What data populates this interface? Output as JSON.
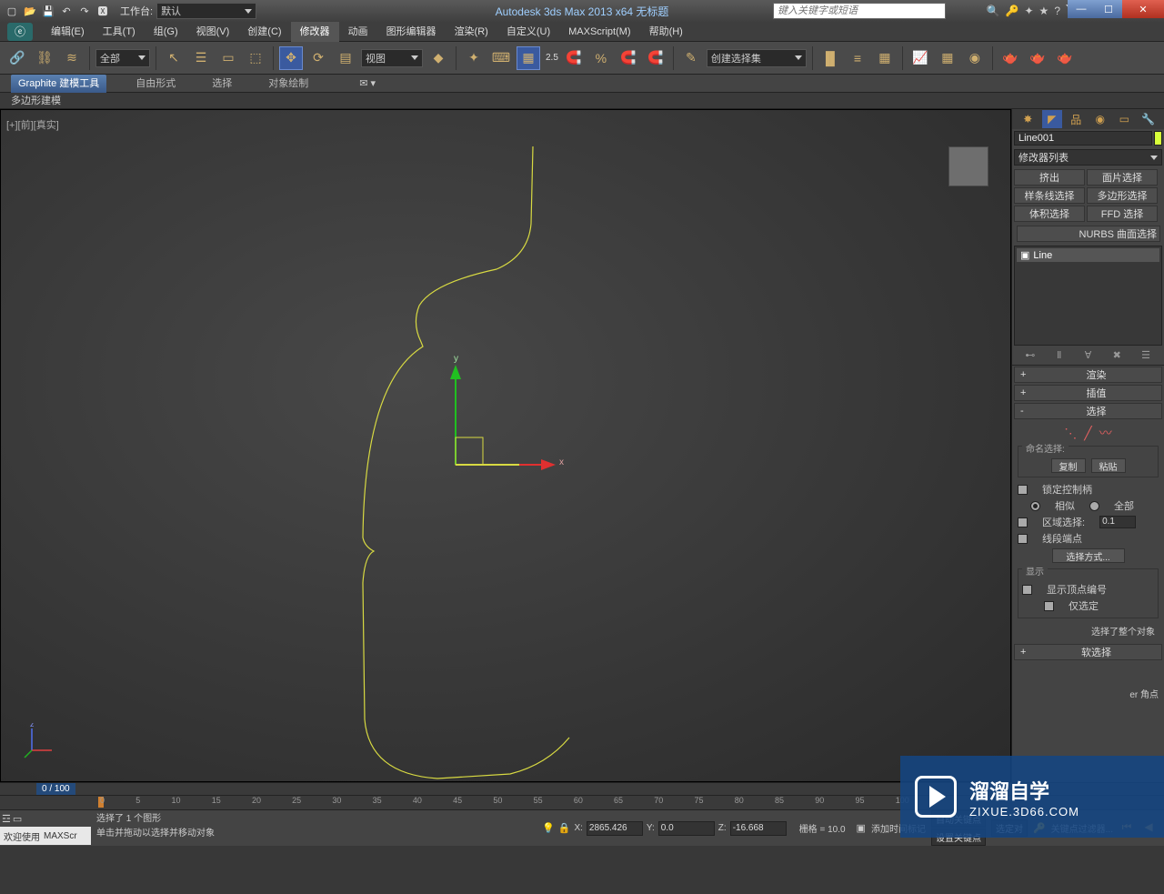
{
  "titlebar": {
    "workspace_label": "工作台:",
    "workspace_value": "默认",
    "app_title": "Autodesk 3ds Max  2013 x64     无标题",
    "search_placeholder": "键入关键字或短语"
  },
  "menu": {
    "items": [
      "编辑(E)",
      "工具(T)",
      "组(G)",
      "视图(V)",
      "创建(C)",
      "修改器",
      "动画",
      "图形编辑器",
      "渲染(R)",
      "自定义(U)",
      "MAXScript(M)",
      "帮助(H)"
    ],
    "active_index": 5
  },
  "toolbar": {
    "filter_dd": "全部",
    "view_dd": "视图",
    "snap_value": "2.5",
    "selset_dd": "创建选择集"
  },
  "ribbon": {
    "tabs": [
      "Graphite 建模工具",
      "自由形式",
      "选择",
      "对象绘制"
    ],
    "active_index": 0,
    "subtab": "多边形建模"
  },
  "viewport": {
    "label": "[+][前][真实]",
    "gizmo_x": "x",
    "gizmo_y": "y",
    "axis_z": "z"
  },
  "cmdpanel": {
    "object_name": "Line001",
    "modlist_label": "修改器列表",
    "mod_buttons": [
      "挤出",
      "面片选择",
      "样条线选择",
      "多边形选择",
      "体积选择",
      "FFD 选择"
    ],
    "mod_full": "NURBS 曲面选择",
    "stack_item": "Line",
    "rollouts": {
      "render": "渲染",
      "interp": "插值",
      "select": "选择",
      "soft": "软选择"
    },
    "select_panel": {
      "named_label": "命名选择:",
      "copy": "复制",
      "paste": "粘贴",
      "lock_handles": "锁定控制柄",
      "similar": "相似",
      "all": "全部",
      "area_select": "区域选择:",
      "area_value": "0.1",
      "seg_end": "线段端点",
      "sel_method": "选择方式...",
      "display_label": "显示",
      "show_vert_num": "显示顶点编号",
      "only_sel": "仅选定",
      "whole_obj": "选择了整个对象"
    },
    "extra": "er 角点"
  },
  "trackbar": {
    "frame": "0 / 100",
    "ticks": [
      "0",
      "5",
      "10",
      "15",
      "20",
      "25",
      "30",
      "35",
      "40",
      "45",
      "50",
      "55",
      "60",
      "65",
      "70",
      "75",
      "80",
      "85",
      "90",
      "95",
      "100"
    ]
  },
  "status": {
    "welcome": "欢迎使用",
    "maxscr": "MAXScr",
    "line1": "选择了 1 个图形",
    "line2": "单击并拖动以选择并移动对象",
    "x_label": "X:",
    "x_val": "2865.426",
    "y_label": "Y:",
    "y_val": "0.0",
    "z_label": "Z:",
    "z_val": "-16.668",
    "grid": "栅格 = 10.0",
    "add_time": "添加时间标记",
    "auto_key": "自动关键点",
    "set_key": "设置关键点",
    "sel_obj": "选定对",
    "key_filter": "关键点过滤器..."
  },
  "watermark": {
    "t1": "溜溜自学",
    "t2": "ZIXUE.3D66.COM"
  }
}
